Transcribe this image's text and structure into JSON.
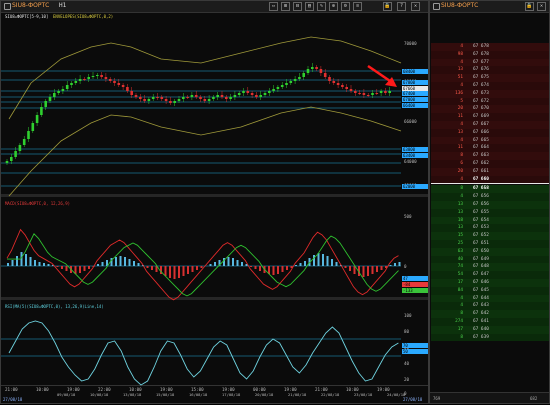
{
  "chart_window": {
    "title": "SIU8-ФОРТС",
    "timeframe": "H1",
    "main_caption": "SIU8=ФОРТС[5-9,10]",
    "envelope_caption": "ENVELOPES(SIU8=ФОРТС,0,2)",
    "macd_caption": "MACD(SIU8=ФОРТС,0, 12,26,9)",
    "rsi_caption": "RSI(MA(5)(SIU8=ФОРТС,0), 13,26,9)Line,14)",
    "price_scale": [
      "70000",
      "68000",
      "66000",
      "64000",
      "62000"
    ],
    "price_boxes": [
      {
        "text": "68400",
        "color": "#2aa9ff"
      },
      {
        "text": "67800",
        "color": "#2aa9ff"
      },
      {
        "text": "67660",
        "color": "#e8e8e8"
      },
      {
        "text": "67400",
        "color": "#2aa9ff"
      },
      {
        "text": "67000",
        "color": "#2aa9ff"
      },
      {
        "text": "66400",
        "color": "#2aa9ff"
      },
      {
        "text": "63800",
        "color": "#2aa9ff"
      },
      {
        "text": "63400",
        "color": "#2aa9ff"
      },
      {
        "text": "62000",
        "color": "#2aa9ff"
      }
    ],
    "macd_scale": [
      "500",
      "0",
      "-500"
    ],
    "macd_boxes": [
      {
        "text": "47",
        "color": "#2aa9ff"
      },
      {
        "text": "-84",
        "color": "#e83a3a"
      },
      {
        "text": "-133",
        "color": "#3ac43a"
      }
    ],
    "rsi_scale": [
      "100",
      "80",
      "60",
      "40",
      "20",
      "0"
    ],
    "rsi_boxes": [
      {
        "text": "70",
        "color": "#2aa9ff"
      },
      {
        "text": "50",
        "color": "#2aa9ff"
      }
    ],
    "time_axis": [
      "21:00",
      "10:00",
      "19:00",
      "22:00",
      "10:00",
      "19:00",
      "15:00",
      "19:00",
      "00:00",
      "19:00",
      "21:00",
      "10:00",
      "19:00"
    ],
    "date_axis": [
      "09/08/18",
      "10/08/18",
      "13/08/18",
      "15/08/18",
      "16/08/18",
      "17/08/18",
      "20/08/18",
      "21/08/18",
      "22/08/18",
      "23/08/18",
      "24/08/18"
    ],
    "corner_left": "27/08/18",
    "corner_right": "27/08/18"
  },
  "orderbook": {
    "title": "SIU8-ФОРТС",
    "footer_left": "769",
    "footer_right": "682",
    "asks": [
      {
        "vol": "4",
        "price": "67 678"
      },
      {
        "vol": "98",
        "price": "67 678"
      },
      {
        "vol": "4",
        "price": "67 677"
      },
      {
        "vol": "13",
        "price": "67 676"
      },
      {
        "vol": "51",
        "price": "67 675"
      },
      {
        "vol": "4",
        "price": "67 674"
      },
      {
        "vol": "136",
        "price": "67 673"
      },
      {
        "vol": "5",
        "price": "67 672"
      },
      {
        "vol": "20",
        "price": "67 670"
      },
      {
        "vol": "11",
        "price": "67 669"
      },
      {
        "vol": "4",
        "price": "67 667"
      },
      {
        "vol": "13",
        "price": "67 666"
      },
      {
        "vol": "4",
        "price": "67 665"
      },
      {
        "vol": "11",
        "price": "67 664"
      },
      {
        "vol": "8",
        "price": "67 663"
      },
      {
        "vol": "6",
        "price": "67 662"
      },
      {
        "vol": "20",
        "price": "67 661"
      },
      {
        "vol": "4",
        "price": "67 660"
      }
    ],
    "bids": [
      {
        "vol": "8",
        "price": "67 658"
      },
      {
        "vol": "4",
        "price": "67 656"
      },
      {
        "vol": "13",
        "price": "67 656"
      },
      {
        "vol": "13",
        "price": "67 655"
      },
      {
        "vol": "18",
        "price": "67 654"
      },
      {
        "vol": "13",
        "price": "67 653"
      },
      {
        "vol": "15",
        "price": "67 652"
      },
      {
        "vol": "25",
        "price": "67 651"
      },
      {
        "vol": "63",
        "price": "67 650"
      },
      {
        "vol": "40",
        "price": "67 649"
      },
      {
        "vol": "74",
        "price": "67 648"
      },
      {
        "vol": "54",
        "price": "67 647"
      },
      {
        "vol": "17",
        "price": "67 646"
      },
      {
        "vol": "84",
        "price": "67 645"
      },
      {
        "vol": "4",
        "price": "67 644"
      },
      {
        "vol": "4",
        "price": "67 643"
      },
      {
        "vol": "8",
        "price": "67 642"
      },
      {
        "vol": "274",
        "price": "67 641"
      },
      {
        "vol": "17",
        "price": "67 640"
      },
      {
        "vol": "8",
        "price": "67 639"
      }
    ]
  }
}
